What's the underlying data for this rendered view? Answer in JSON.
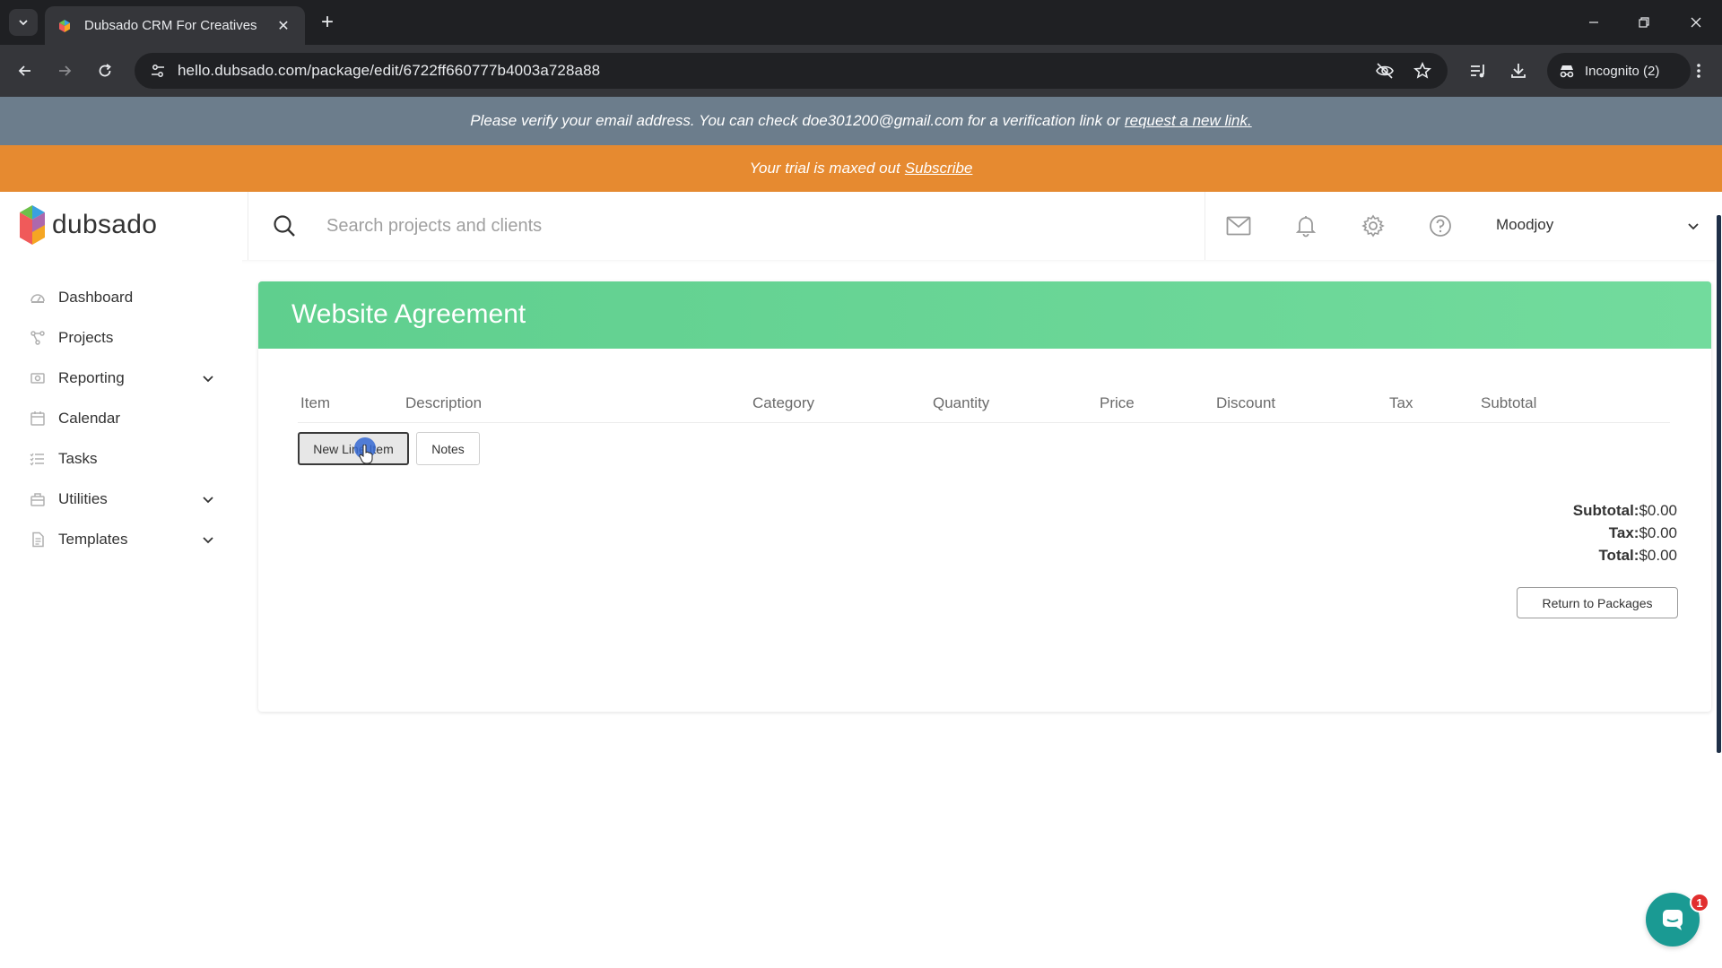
{
  "browser": {
    "tab_title": "Dubsado CRM For Creatives",
    "url": "hello.dubsado.com/package/edit/6722ff660777b4003a728a88",
    "incognito_label": "Incognito (2)"
  },
  "banners": {
    "verify_text": "Please verify your email address. You can check doe301200@gmail.com for a verification link or",
    "verify_link": "request a new link.",
    "trial_text": "Your trial is maxed out",
    "trial_link": "Subscribe"
  },
  "header": {
    "logo_text": "dubsado",
    "search_placeholder": "Search projects and clients",
    "user_name": "Moodjoy"
  },
  "sidebar": {
    "items": [
      {
        "label": "Dashboard",
        "icon": "dashboard-icon"
      },
      {
        "label": "Projects",
        "icon": "projects-icon"
      },
      {
        "label": "Reporting",
        "icon": "reporting-icon",
        "expandable": true
      },
      {
        "label": "Calendar",
        "icon": "calendar-icon"
      },
      {
        "label": "Tasks",
        "icon": "tasks-icon"
      },
      {
        "label": "Utilities",
        "icon": "utilities-icon",
        "expandable": true
      },
      {
        "label": "Templates",
        "icon": "templates-icon",
        "expandable": true
      }
    ]
  },
  "package": {
    "title": "Website Agreement",
    "columns": [
      "Item",
      "Description",
      "Category",
      "Quantity",
      "Price",
      "Discount",
      "Tax",
      "Subtotal"
    ],
    "new_line_item_label": "New Line Item",
    "notes_label": "Notes",
    "subtotal_label": "Subtotal:",
    "subtotal_value": "$0.00",
    "tax_label": "Tax:",
    "tax_value": "$0.00",
    "total_label": "Total:",
    "total_value": "$0.00",
    "return_label": "Return to Packages"
  },
  "chat": {
    "badge_count": "1"
  },
  "colors": {
    "card_header_green": "#5fcf8e",
    "trial_orange": "#e68a30",
    "verify_gray": "#6c7d8c",
    "chat_teal": "#1a9a93"
  }
}
